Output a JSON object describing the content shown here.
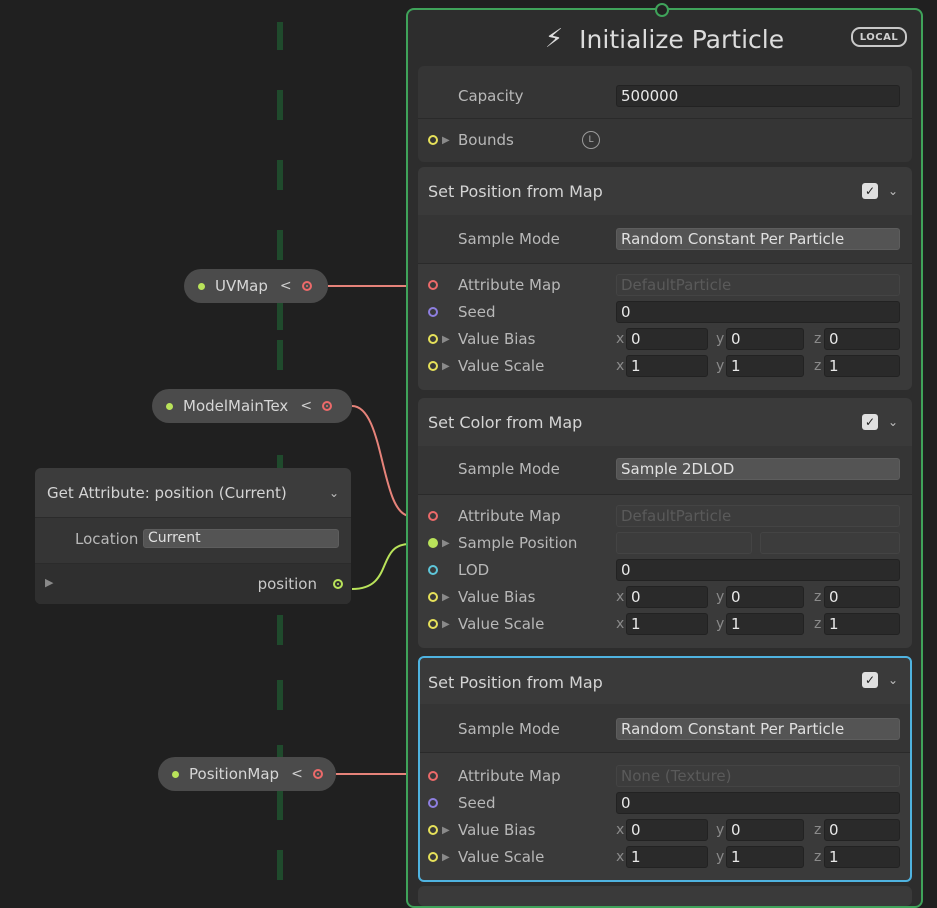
{
  "context": {
    "title": "Initialize Particle",
    "badge": "LOCAL",
    "capacity_label": "Capacity",
    "capacity_value": "500000",
    "bounds_label": "Bounds",
    "bounds_badge": "L"
  },
  "block1": {
    "title": "Set Position from Map",
    "sample_mode_label": "Sample Mode",
    "sample_mode_value": "Random Constant Per Particle",
    "attribute_map_label": "Attribute Map",
    "attribute_map_value": "DefaultParticle",
    "seed_label": "Seed",
    "seed_value": "0",
    "value_bias_label": "Value Bias",
    "value_bias": {
      "x": "0",
      "y": "0",
      "z": "0"
    },
    "value_scale_label": "Value Scale",
    "value_scale": {
      "x": "1",
      "y": "1",
      "z": "1"
    }
  },
  "block2": {
    "title": "Set Color from Map",
    "sample_mode_label": "Sample Mode",
    "sample_mode_value": "Sample 2DLOD",
    "attribute_map_label": "Attribute Map",
    "attribute_map_value": "DefaultParticle",
    "sample_position_label": "Sample Position",
    "lod_label": "LOD",
    "lod_value": "0",
    "value_bias_label": "Value Bias",
    "value_bias": {
      "x": "0",
      "y": "0",
      "z": "0"
    },
    "value_scale_label": "Value Scale",
    "value_scale": {
      "x": "1",
      "y": "1",
      "z": "1"
    }
  },
  "block3": {
    "title": "Set Position from Map",
    "sample_mode_label": "Sample Mode",
    "sample_mode_value": "Random Constant Per Particle",
    "attribute_map_label": "Attribute Map",
    "attribute_map_value": "None (Texture)",
    "seed_label": "Seed",
    "seed_value": "0",
    "value_bias_label": "Value Bias",
    "value_bias": {
      "x": "0",
      "y": "0",
      "z": "0"
    },
    "value_scale_label": "Value Scale",
    "value_scale": {
      "x": "1",
      "y": "1",
      "z": "1"
    }
  },
  "pills": {
    "uvmap": "UVMap",
    "modelmaintex": "ModelMainTex",
    "positionmap": "PositionMap",
    "collapse_glyph": "<"
  },
  "get_attribute": {
    "title": "Get Attribute: position (Current)",
    "location_label": "Location",
    "location_value": "Current",
    "output_label": "position"
  },
  "axis_labels": {
    "x": "x",
    "y": "y",
    "z": "z"
  },
  "colors": {
    "context_border": "#3fa35a",
    "selected_border": "#4fb3e0",
    "texture_port": "#ec6a6a",
    "float_port": "#8e7fe0",
    "vector_port": "#e6e15a",
    "uint_port": "#5ec6d9",
    "position_port": "#b9e35a"
  }
}
